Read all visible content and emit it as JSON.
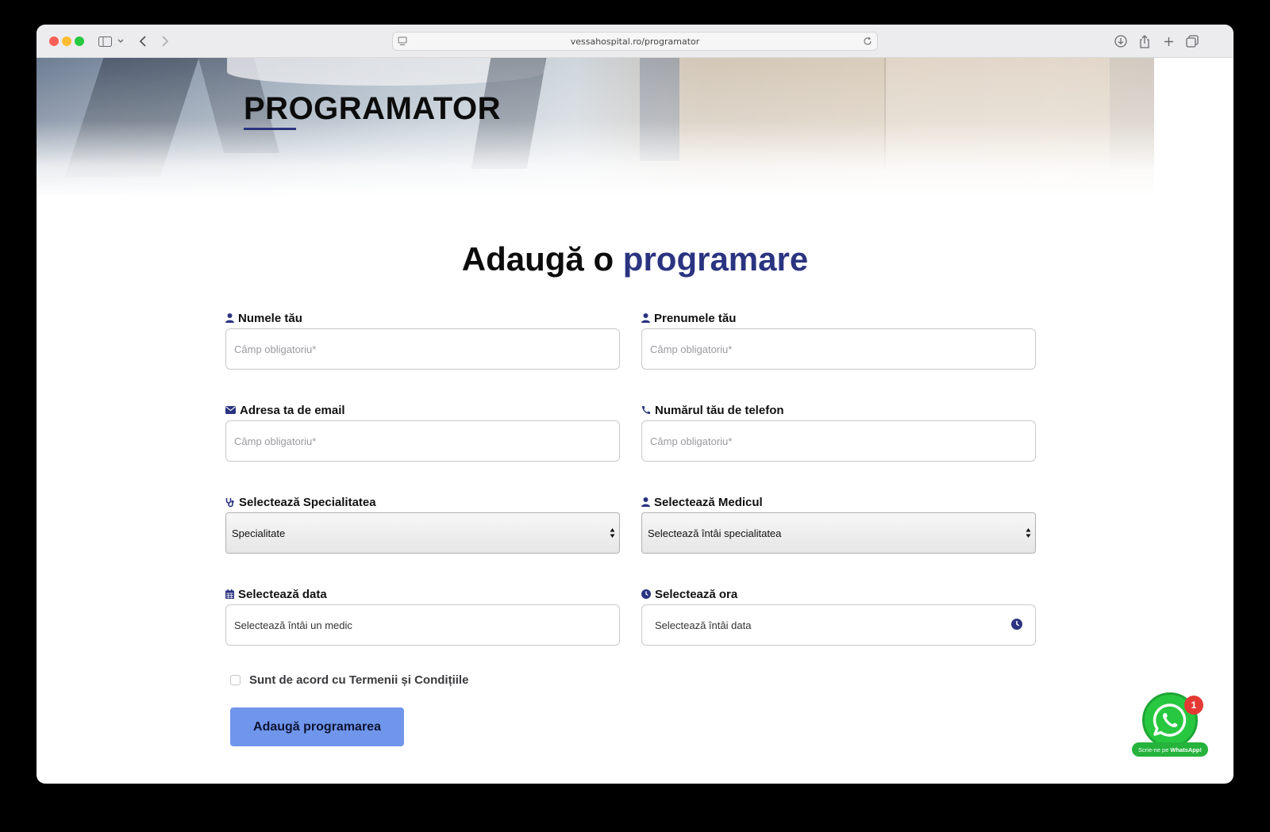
{
  "browser": {
    "url": "vessahospital.ro/programator"
  },
  "hero": {
    "title": "PROGRAMATOR"
  },
  "form": {
    "heading_part1": "Adaugă o",
    "heading_part2": "programare",
    "fields": {
      "last_name": {
        "label": "Numele tău",
        "placeholder": "Câmp obligatoriu*"
      },
      "first_name": {
        "label": "Prenumele tău",
        "placeholder": "Câmp obligatoriu*"
      },
      "email": {
        "label": "Adresa ta de email",
        "placeholder": "Câmp obligatoriu*"
      },
      "phone": {
        "label": "Numărul tău de telefon",
        "placeholder": "Câmp obligatoriu*"
      },
      "specialty": {
        "label": "Selectează Specialitatea",
        "value": "Specialitate"
      },
      "doctor": {
        "label": "Selectează Medicul",
        "value": "Selectează întâi specialitatea"
      },
      "date": {
        "label": "Selectează data",
        "value": "Selectează întâi un medic"
      },
      "time": {
        "label": "Selectează ora",
        "value": "Selectează întâi data"
      }
    },
    "terms_label": "Sunt de acord cu Termenii și Condițiile",
    "submit_label": "Adaugă programarea"
  },
  "whatsapp": {
    "badge_count": "1",
    "label_prefix": "Scrie-ne pe",
    "label_brand": "WhatsApp!"
  },
  "colors": {
    "accent": "#2b3480",
    "button": "#7096ec",
    "whatsapp_green": "#27c840",
    "badge_red": "#e53935"
  },
  "icons": [
    "user-icon",
    "envelope-icon",
    "phone-icon",
    "stethoscope-icon",
    "calendar-icon",
    "clock-icon",
    "whatsapp-icon"
  ]
}
